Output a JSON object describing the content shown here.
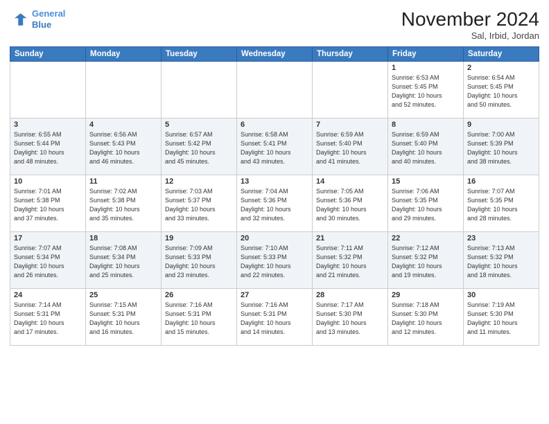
{
  "logo": {
    "line1": "General",
    "line2": "Blue"
  },
  "title": "November 2024",
  "location": "Sal, Irbid, Jordan",
  "weekdays": [
    "Sunday",
    "Monday",
    "Tuesday",
    "Wednesday",
    "Thursday",
    "Friday",
    "Saturday"
  ],
  "weeks": [
    [
      {
        "day": "",
        "info": ""
      },
      {
        "day": "",
        "info": ""
      },
      {
        "day": "",
        "info": ""
      },
      {
        "day": "",
        "info": ""
      },
      {
        "day": "",
        "info": ""
      },
      {
        "day": "1",
        "info": "Sunrise: 6:53 AM\nSunset: 5:45 PM\nDaylight: 10 hours\nand 52 minutes."
      },
      {
        "day": "2",
        "info": "Sunrise: 6:54 AM\nSunset: 5:45 PM\nDaylight: 10 hours\nand 50 minutes."
      }
    ],
    [
      {
        "day": "3",
        "info": "Sunrise: 6:55 AM\nSunset: 5:44 PM\nDaylight: 10 hours\nand 48 minutes."
      },
      {
        "day": "4",
        "info": "Sunrise: 6:56 AM\nSunset: 5:43 PM\nDaylight: 10 hours\nand 46 minutes."
      },
      {
        "day": "5",
        "info": "Sunrise: 6:57 AM\nSunset: 5:42 PM\nDaylight: 10 hours\nand 45 minutes."
      },
      {
        "day": "6",
        "info": "Sunrise: 6:58 AM\nSunset: 5:41 PM\nDaylight: 10 hours\nand 43 minutes."
      },
      {
        "day": "7",
        "info": "Sunrise: 6:59 AM\nSunset: 5:40 PM\nDaylight: 10 hours\nand 41 minutes."
      },
      {
        "day": "8",
        "info": "Sunrise: 6:59 AM\nSunset: 5:40 PM\nDaylight: 10 hours\nand 40 minutes."
      },
      {
        "day": "9",
        "info": "Sunrise: 7:00 AM\nSunset: 5:39 PM\nDaylight: 10 hours\nand 38 minutes."
      }
    ],
    [
      {
        "day": "10",
        "info": "Sunrise: 7:01 AM\nSunset: 5:38 PM\nDaylight: 10 hours\nand 37 minutes."
      },
      {
        "day": "11",
        "info": "Sunrise: 7:02 AM\nSunset: 5:38 PM\nDaylight: 10 hours\nand 35 minutes."
      },
      {
        "day": "12",
        "info": "Sunrise: 7:03 AM\nSunset: 5:37 PM\nDaylight: 10 hours\nand 33 minutes."
      },
      {
        "day": "13",
        "info": "Sunrise: 7:04 AM\nSunset: 5:36 PM\nDaylight: 10 hours\nand 32 minutes."
      },
      {
        "day": "14",
        "info": "Sunrise: 7:05 AM\nSunset: 5:36 PM\nDaylight: 10 hours\nand 30 minutes."
      },
      {
        "day": "15",
        "info": "Sunrise: 7:06 AM\nSunset: 5:35 PM\nDaylight: 10 hours\nand 29 minutes."
      },
      {
        "day": "16",
        "info": "Sunrise: 7:07 AM\nSunset: 5:35 PM\nDaylight: 10 hours\nand 28 minutes."
      }
    ],
    [
      {
        "day": "17",
        "info": "Sunrise: 7:07 AM\nSunset: 5:34 PM\nDaylight: 10 hours\nand 26 minutes."
      },
      {
        "day": "18",
        "info": "Sunrise: 7:08 AM\nSunset: 5:34 PM\nDaylight: 10 hours\nand 25 minutes."
      },
      {
        "day": "19",
        "info": "Sunrise: 7:09 AM\nSunset: 5:33 PM\nDaylight: 10 hours\nand 23 minutes."
      },
      {
        "day": "20",
        "info": "Sunrise: 7:10 AM\nSunset: 5:33 PM\nDaylight: 10 hours\nand 22 minutes."
      },
      {
        "day": "21",
        "info": "Sunrise: 7:11 AM\nSunset: 5:32 PM\nDaylight: 10 hours\nand 21 minutes."
      },
      {
        "day": "22",
        "info": "Sunrise: 7:12 AM\nSunset: 5:32 PM\nDaylight: 10 hours\nand 19 minutes."
      },
      {
        "day": "23",
        "info": "Sunrise: 7:13 AM\nSunset: 5:32 PM\nDaylight: 10 hours\nand 18 minutes."
      }
    ],
    [
      {
        "day": "24",
        "info": "Sunrise: 7:14 AM\nSunset: 5:31 PM\nDaylight: 10 hours\nand 17 minutes."
      },
      {
        "day": "25",
        "info": "Sunrise: 7:15 AM\nSunset: 5:31 PM\nDaylight: 10 hours\nand 16 minutes."
      },
      {
        "day": "26",
        "info": "Sunrise: 7:16 AM\nSunset: 5:31 PM\nDaylight: 10 hours\nand 15 minutes."
      },
      {
        "day": "27",
        "info": "Sunrise: 7:16 AM\nSunset: 5:31 PM\nDaylight: 10 hours\nand 14 minutes."
      },
      {
        "day": "28",
        "info": "Sunrise: 7:17 AM\nSunset: 5:30 PM\nDaylight: 10 hours\nand 13 minutes."
      },
      {
        "day": "29",
        "info": "Sunrise: 7:18 AM\nSunset: 5:30 PM\nDaylight: 10 hours\nand 12 minutes."
      },
      {
        "day": "30",
        "info": "Sunrise: 7:19 AM\nSunset: 5:30 PM\nDaylight: 10 hours\nand 11 minutes."
      }
    ]
  ]
}
